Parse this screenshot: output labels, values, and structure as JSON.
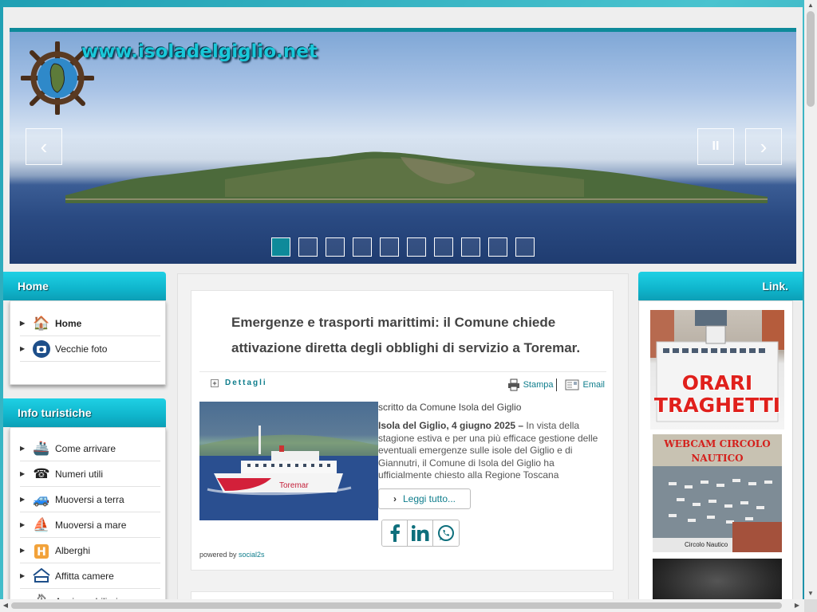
{
  "site": {
    "url": "www.isoladelgiglio.net"
  },
  "slider": {
    "prev_label": "‹",
    "next_label": "›",
    "pause_label": "II",
    "slide_count": 10,
    "active_slide": 1
  },
  "left_menu": {
    "home_title": "Home",
    "home_items": [
      {
        "label": "Home",
        "icon": "house-icon"
      },
      {
        "label": "Vecchie foto",
        "icon": "camera-icon"
      }
    ],
    "info_title": "Info turistiche",
    "info_items": [
      {
        "label": "Come arrivare",
        "icon": "ship-icon"
      },
      {
        "label": "Numeri utili",
        "icon": "phone-icon"
      },
      {
        "label": "Muoversi a terra",
        "icon": "car-icon"
      },
      {
        "label": "Muoversi a mare",
        "icon": "sailboat-icon"
      },
      {
        "label": "Alberghi",
        "icon": "hotel-icon"
      },
      {
        "label": "Affitta camere",
        "icon": "bed-icon"
      },
      {
        "label": "Ag. immobiliari",
        "icon": "real-estate-icon"
      }
    ]
  },
  "right_menu": {
    "title": "Link.",
    "banners": [
      {
        "label": "ORARI TRAGHETTI"
      },
      {
        "label": "WEBCAM CIRCOLO NAUTICO",
        "caption": "Circolo Nautico"
      }
    ]
  },
  "article": {
    "title": "Emergenze e trasporti marittimi: il Comune chiede attivazione diretta degli obblighi di servizio a Toremar.",
    "details_label": "Dettagli",
    "print_label": "Stampa",
    "email_label": "Email",
    "byline": "scritto da Comune Isola del Giglio",
    "lead_bold": "Isola del Giglio, 4 giugno 2025 –",
    "lead_text": " In vista della stagione estiva e per una più efficace gestione delle eventuali emergenze sulle isole del Giglio e di Giannutri, il Comune di Isola del Giglio ha ufficialmente chiesto alla Regione Toscana",
    "read_more_label": "Leggi tutto...",
    "ferry_name": "Toremar",
    "share": [
      "facebook-icon",
      "linkedin-icon",
      "whatsapp-icon"
    ],
    "powered_by": "powered by",
    "powered_by_link": "social2s"
  },
  "colors": {
    "accent": "#0e8a9a",
    "menu_header": "#13bfd6",
    "link": "#0e7d8c"
  }
}
